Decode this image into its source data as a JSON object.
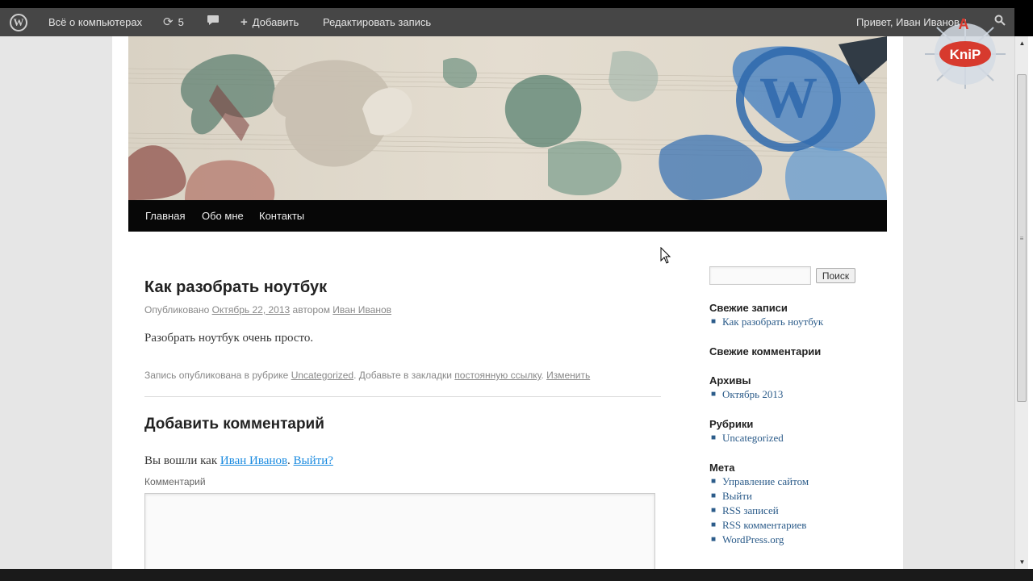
{
  "adminbar": {
    "site_name": "Всё о компьютерах",
    "updates_count": "5",
    "add_new": "Добавить",
    "edit_post": "Редактировать запись",
    "greeting": "Привет, Иван Иванов"
  },
  "nav": {
    "items": [
      "Главная",
      "Обо мне",
      "Контакты"
    ]
  },
  "post": {
    "title": "Как разобрать ноутбук",
    "meta_prefix": "Опубликовано",
    "date": "Октябрь 22, 2013",
    "meta_author_prefix": "автором",
    "author": "Иван Иванов",
    "body": "Разобрать ноутбук очень просто.",
    "footer_prefix": "Запись опубликована в рубрике",
    "category": "Uncategorized",
    "footer_middle": ". Добавьте в закладки",
    "permalink": "постоянную ссылку",
    "edit": "Изменить"
  },
  "comments": {
    "reply_title": "Добавить комментарий",
    "logged_in_prefix": "Вы вошли как",
    "user": "Иван Иванов",
    "logout": "Выйти?",
    "label": "Комментарий",
    "value": ""
  },
  "sidebar": {
    "search_button": "Поиск",
    "search_value": "",
    "recent_posts_title": "Свежие записи",
    "recent_posts": [
      "Как разобрать ноутбук"
    ],
    "recent_comments_title": "Свежие комментарии",
    "archives_title": "Архивы",
    "archives": [
      "Октябрь 2013"
    ],
    "categories_title": "Рубрики",
    "categories": [
      "Uncategorized"
    ],
    "meta_title": "Мета",
    "meta_links": [
      "Управление сайтом",
      "Выйти",
      "RSS записей",
      "RSS комментариев",
      "WordPress.org"
    ]
  },
  "watermark": {
    "text": "KniP"
  },
  "colors": {
    "adminbar_bg": "#464646",
    "nav_bg": "#070707",
    "link": "#1b8be0",
    "sidebar_link": "#2c5c8a"
  }
}
